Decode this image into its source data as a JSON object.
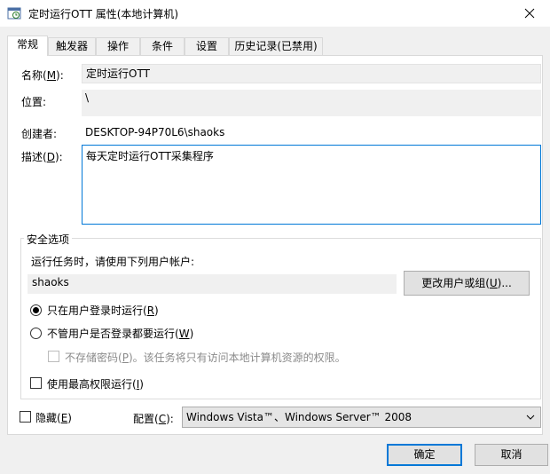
{
  "window": {
    "title": "定时运行OTT 属性(本地计算机)"
  },
  "tabs": [
    {
      "label": "常规",
      "active": true
    },
    {
      "label": "触发器"
    },
    {
      "label": "操作"
    },
    {
      "label": "条件"
    },
    {
      "label": "设置"
    },
    {
      "label": "历史记录(已禁用)"
    }
  ],
  "general": {
    "name_label_pre": "名称(",
    "name_label_key": "M",
    "name_label_post": "):",
    "name_value": "定时运行OTT",
    "location_label": "位置:",
    "location_value": "\\",
    "author_label": "创建者:",
    "author_value": "DESKTOP-94P70L6\\shaoks",
    "desc_label_pre": "描述(",
    "desc_label_key": "D",
    "desc_label_post": "):",
    "desc_value": "每天定时运行OTT采集程序"
  },
  "security": {
    "group_title": "安全选项",
    "run_as_prompt": "运行任务时，请使用下列用户帐户:",
    "user_value": "shaoks",
    "change_user_pre": "更改用户或组(",
    "change_user_key": "U",
    "change_user_post": ")...",
    "radio1_pre": "只在用户登录时运行(",
    "radio1_key": "R",
    "radio1_post": ")",
    "radio2_pre": "不管用户是否登录都要运行(",
    "radio2_key": "W",
    "radio2_post": ")",
    "no_store_pre": "不存储密码(",
    "no_store_key": "P",
    "no_store_post": ")。该任务将只有访问本地计算机资源的权限。",
    "highest_pre": "使用最高权限运行(",
    "highest_key": "I",
    "highest_post": ")"
  },
  "bottom": {
    "hidden_pre": "隐藏(",
    "hidden_key": "E",
    "hidden_post": ")",
    "config_pre": "配置(",
    "config_key": "C",
    "config_post": "):",
    "config_value": "Windows Vista™、Windows Server™ 2008"
  },
  "buttons": {
    "ok": "确定",
    "cancel": "取消"
  },
  "colors": {
    "accent": "#0078d7"
  }
}
